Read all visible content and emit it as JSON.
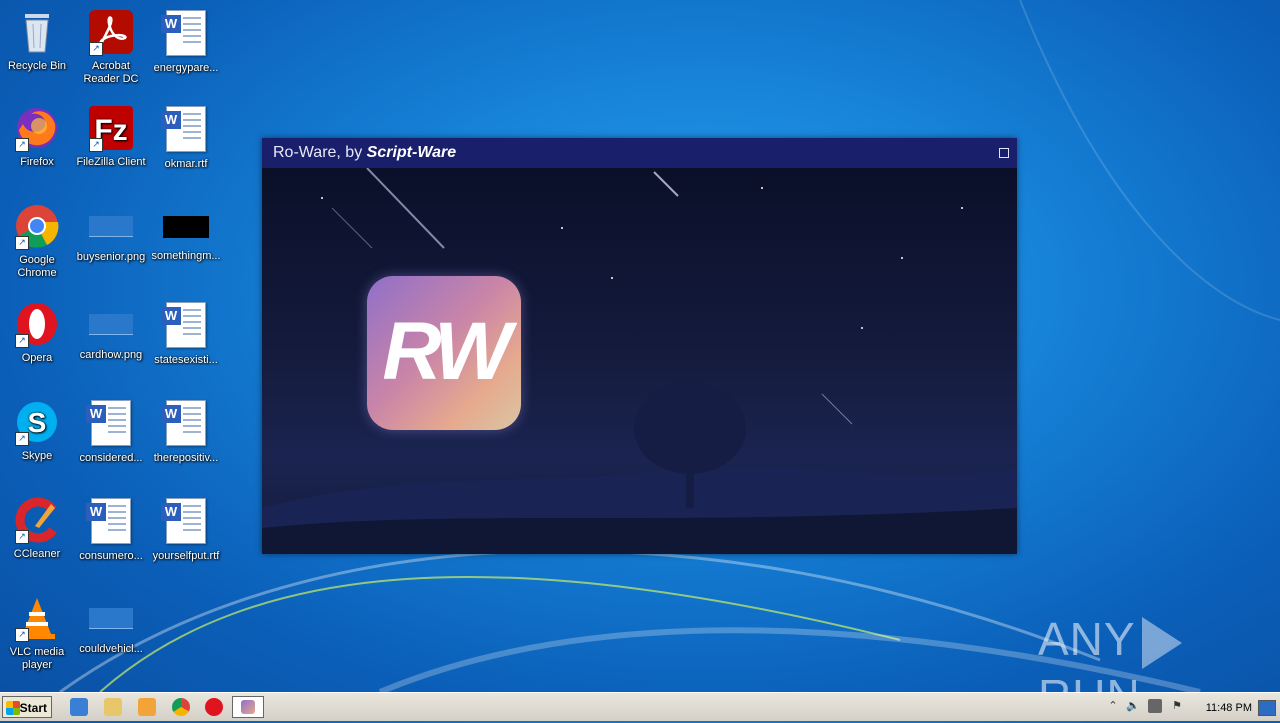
{
  "desktop": {
    "icons": [
      {
        "id": "recycle-bin",
        "label": "Recycle Bin"
      },
      {
        "id": "acrobat",
        "label": "Acrobat Reader DC"
      },
      {
        "id": "energypare",
        "label": "energypare..."
      },
      {
        "id": "firefox",
        "label": "Firefox"
      },
      {
        "id": "filezilla",
        "label": "FileZilla Client"
      },
      {
        "id": "okmar",
        "label": "okmar.rtf"
      },
      {
        "id": "chrome",
        "label": "Google Chrome"
      },
      {
        "id": "buysenior",
        "label": "buysenior.png"
      },
      {
        "id": "somethingm",
        "label": "somethingm..."
      },
      {
        "id": "opera",
        "label": "Opera"
      },
      {
        "id": "cardhow",
        "label": "cardhow.png"
      },
      {
        "id": "statesexisti",
        "label": "statesexisti..."
      },
      {
        "id": "skype",
        "label": "Skype"
      },
      {
        "id": "considered",
        "label": "considered..."
      },
      {
        "id": "therepositiv",
        "label": "therepositiv..."
      },
      {
        "id": "ccleaner",
        "label": "CCleaner"
      },
      {
        "id": "consumero",
        "label": "consumero..."
      },
      {
        "id": "yourselfput",
        "label": "yourselfput.rtf"
      },
      {
        "id": "vlc",
        "label": "VLC media player"
      },
      {
        "id": "couldvehicl",
        "label": "couldvehicl..."
      }
    ]
  },
  "app_window": {
    "title_prefix": "Ro-Ware, by ",
    "title_brand": "Script-Ware",
    "logo_text": "RW"
  },
  "watermark": {
    "left": "ANY",
    "right": "RUN"
  },
  "taskbar": {
    "start_label": "Start",
    "clock": "11:48 PM",
    "tray_arrow": "⌃"
  }
}
